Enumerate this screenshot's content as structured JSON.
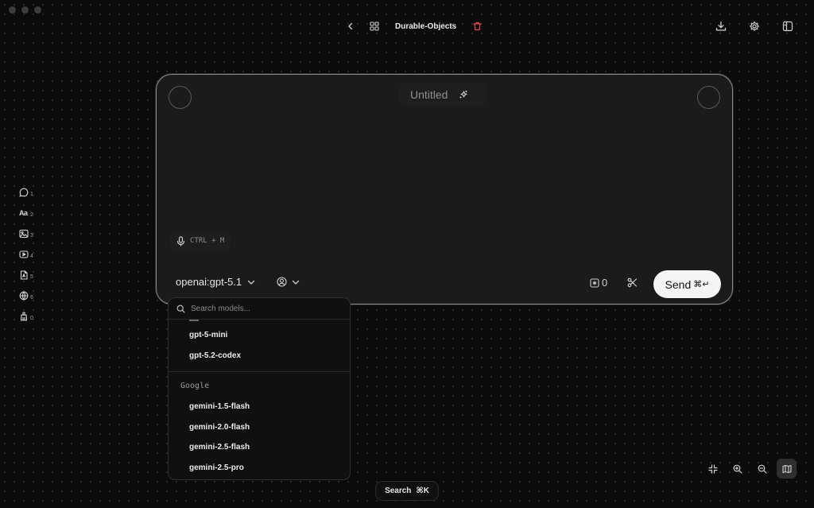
{
  "header": {
    "title": "Durable-Objects"
  },
  "tools": [
    {
      "icon": "chat-bubble-icon",
      "shortcut": "1"
    },
    {
      "icon": "text-aa-icon",
      "label": "Aa",
      "shortcut": "2"
    },
    {
      "icon": "image-icon",
      "shortcut": "3"
    },
    {
      "icon": "video-icon",
      "shortcut": "4"
    },
    {
      "icon": "pdf-file-icon",
      "shortcut": "5"
    },
    {
      "icon": "globe-icon",
      "shortcut": "6"
    },
    {
      "icon": "cleanup-icon",
      "shortcut": "0"
    }
  ],
  "card": {
    "title": "Untitled",
    "voice_hint": "CTRL + M",
    "model": "openai:gpt-5.1",
    "context_count": "0",
    "send_label": "Send",
    "send_shortcut": "⌘↵"
  },
  "dropdown": {
    "search_placeholder": "Search models...",
    "openai_items": [
      "gpt-5-mini",
      "gpt-5.2-codex"
    ],
    "group_google": "Google",
    "google_items": [
      "gemini-1.5-flash",
      "gemini-2.0-flash",
      "gemini-2.5-flash",
      "gemini-2.5-pro"
    ]
  },
  "bottom": {
    "search_label": "Search",
    "search_shortcut": "⌘K"
  },
  "colors": {
    "background": "#0b0b0b",
    "card": "#1b1b1b",
    "trash_accent": "#e5484d",
    "send_button": "#f5f5f5"
  }
}
